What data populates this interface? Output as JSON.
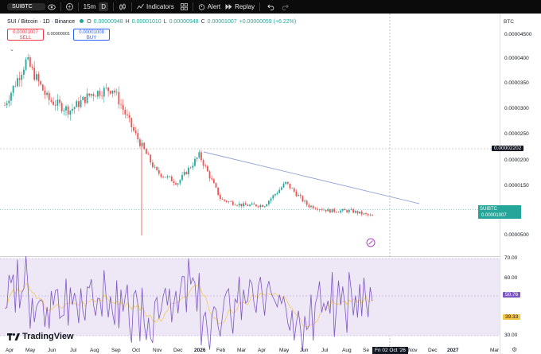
{
  "toolbar": {
    "symbol": "SUIBTC",
    "interval_15m": "15m",
    "interval_d": "D",
    "indicators": "Indicators",
    "alert": "Alert",
    "replay": "Replay",
    "icons": [
      "eye-icon",
      "plus-circle-icon",
      "chart-type-icon",
      "indicators-icon",
      "alert-icon",
      "replay-icon",
      "undo-icon",
      "redo-icon"
    ]
  },
  "legend": {
    "title": "SUI / Bitcoin · 1D · Binance",
    "o_label": "O",
    "o_val": "0.00000948",
    "h_label": "H",
    "h_val": "0.00001010",
    "l_label": "L",
    "l_val": "0.00000948",
    "c_label": "C",
    "c_val": "0.00001007",
    "change": "+0.00000059 (+6.22%)"
  },
  "trade": {
    "sell_price": "0.00001007",
    "sell_label": "SELL",
    "spread": "0.00000001",
    "buy_price": "0.00001008",
    "buy_label": "BUY"
  },
  "y_axis": {
    "currency": "BTC",
    "labels": [
      "0.00004500",
      "0.0000400",
      "0.0000350",
      "0.0000300",
      "0.0000250",
      "0.0000200",
      "0.0000150",
      "0.0000500"
    ],
    "crosshair_price": "0.00002202",
    "pair_badge_symbol": "SUIBTC",
    "pair_badge_price": "0.00001007",
    "pair_badge_time": "11:14:20"
  },
  "rsi_axis": {
    "labels": [
      "70.00",
      "60.00",
      "30.00"
    ],
    "rsi_value": "50.76",
    "ma_value": "39.33",
    "rsi_color": "#7e57c2",
    "ma_color": "#f7c548",
    "band_color": "#ede7f6"
  },
  "x_axis": {
    "labels": [
      "Apr",
      "May",
      "Jun",
      "Jul",
      "Aug",
      "Sep",
      "Oct",
      "Nov",
      "Dec",
      "2026",
      "Feb",
      "Mar",
      "Apr",
      "May",
      "Jun",
      "Jul",
      "Aug",
      "Se",
      "Nov",
      "Dec",
      "2027",
      "Mar"
    ],
    "crosshair_date": "Fri 02 Oct '26"
  },
  "branding": {
    "logo_text": "TradingView"
  },
  "colors": {
    "up": "#26a69a",
    "down": "#ef5350",
    "trendline": "#90a4d4",
    "toolbar_bg": "#0b0b0b"
  },
  "chart_data": {
    "type": "candlestick",
    "title": "SUI / Bitcoin · 1D · Binance",
    "x_range": [
      "Apr 2025",
      "Mar 2027"
    ],
    "ylim": [
      5e-06,
      4.5e-05
    ],
    "approx_price_path": [
      {
        "date": "Apr 2025",
        "price": 3e-05
      },
      {
        "date": "May 2025",
        "price": 3.8e-05
      },
      {
        "date": "Jun 2025",
        "price": 3.1e-05
      },
      {
        "date": "Jul 2025",
        "price": 2.9e-05
      },
      {
        "date": "Aug 2025",
        "price": 3.2e-05
      },
      {
        "date": "Sep 2025",
        "price": 3.3e-05
      },
      {
        "date": "Oct 2025",
        "price": 2.5e-05
      },
      {
        "date": "Nov 2025",
        "price": 1.8e-05
      },
      {
        "date": "Dec 2025",
        "price": 1.6e-05
      },
      {
        "date": "Jan 2026",
        "price": 2.1e-05
      },
      {
        "date": "Feb 2026",
        "price": 1.3e-05
      },
      {
        "date": "Mar 2026",
        "price": 1.2e-05
      },
      {
        "date": "Apr 2026",
        "price": 1.2e-05
      },
      {
        "date": "May 2026",
        "price": 1.6e-05
      },
      {
        "date": "Jun 2026",
        "price": 1.2e-05
      },
      {
        "date": "Jul 2026",
        "price": 1.1e-05
      },
      {
        "date": "Aug 2026",
        "price": 1.1e-05
      },
      {
        "date": "Sep 2026",
        "price": 1e-05
      }
    ]
  }
}
